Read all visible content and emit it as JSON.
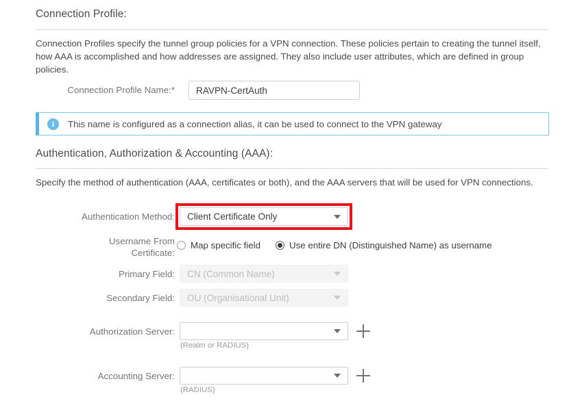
{
  "connection_profile": {
    "heading": "Connection Profile:",
    "description": "Connection Profiles specify the tunnel group policies for a VPN connection. These policies pertain to creating the tunnel itself, how AAA is accomplished and how addresses are assigned. They also include user attributes, which are defined in group policies.",
    "name_label": "Connection Profile Name:*",
    "name_value": "RAVPN-CertAuth",
    "info_banner": {
      "icon": "info-icon",
      "text": "This name is configured as a connection alias, it can be used to connect to the VPN gateway",
      "accent_color": "#5bb4e5"
    }
  },
  "aaa": {
    "heading": "Authentication, Authorization & Accounting (AAA):",
    "description": "Specify the method of authentication (AAA, certificates or both), and the AAA servers that will be used for VPN connections.",
    "auth_method": {
      "label": "Authentication Method:",
      "value": "Client Certificate Only",
      "highlight_color": "#e8141c"
    },
    "username_from_certificate": {
      "label_line1": "Username From",
      "label_line2": "Certificate:",
      "options": [
        {
          "label": "Map specific field",
          "selected": false
        },
        {
          "label": "Use entire DN (Distinguished Name) as username",
          "selected": true
        }
      ]
    },
    "primary_field": {
      "label": "Primary Field:",
      "value": "CN (Common Name)",
      "disabled": true
    },
    "secondary_field": {
      "label": "Secondary Field:",
      "value": "OU (Organisational Unit)",
      "disabled": true
    },
    "authorization_server": {
      "label": "Authorization Server:",
      "value": "",
      "hint": "(Realm or RADIUS)",
      "add_button": "plus-icon"
    },
    "accounting_server": {
      "label": "Accounting Server:",
      "value": "",
      "hint": "(RADIUS)",
      "add_button": "plus-icon"
    }
  }
}
